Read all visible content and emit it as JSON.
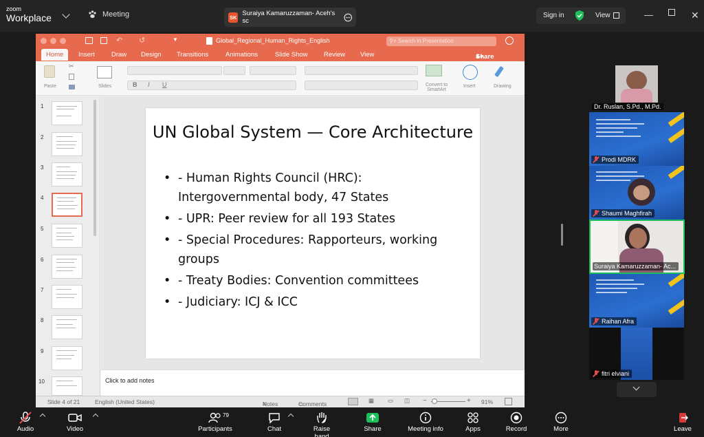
{
  "zoom": {
    "logo_small": "zoom",
    "logo_big": "Workplace",
    "meeting_tab": "Meeting",
    "share_initials": "SK",
    "share_title": "Suraiya Kamaruzzaman- Aceh's sc",
    "sign_in": "Sign in",
    "view": "View",
    "accent": "#1dbf5b"
  },
  "ppt": {
    "filename": "Global_Regional_Human_Rights_English",
    "search_placeholder": "Search in Presentation",
    "tabs": [
      "Home",
      "Insert",
      "Draw",
      "Design",
      "Transitions",
      "Animations",
      "Slide Show",
      "Review",
      "View"
    ],
    "share": "Share",
    "ribbon": {
      "paste": "Paste",
      "slides": "Slides",
      "convert": "Convert to SmartArt",
      "insert": "Insert",
      "drawing": "Drawing"
    },
    "thumb_numbers": [
      "1",
      "2",
      "3",
      "4",
      "5",
      "6",
      "7",
      "8",
      "9",
      "10"
    ],
    "selected_slide": 4,
    "slide": {
      "title": "UN Global System — Core Architecture",
      "bullets": [
        "- Human Rights Council (HRC): Intergovernmental body, 47 States",
        "- UPR: Peer review for all 193 States",
        "- Special Procedures: Rapporteurs, working groups",
        "- Treaty Bodies: Convention committees",
        "- Judiciary: ICJ & ICC"
      ]
    },
    "notes_placeholder": "Click to add notes",
    "status": {
      "slide_of": "Slide 4 of 21",
      "language": "English (United States)",
      "notes": "Notes",
      "comments": "Comments",
      "zoom": "91%"
    },
    "accent": "#e76a4e"
  },
  "participants": [
    {
      "name": "Dr. Ruslan, S.Pd., M.Pd.",
      "type": "video"
    },
    {
      "name": "Prodi MDRK",
      "type": "poster"
    },
    {
      "name": "Shaumi Maghfirah",
      "type": "poster-video"
    },
    {
      "name": "Suraiya Kamaruzzaman- Ac...",
      "type": "video-active"
    },
    {
      "name": "Raihan Afra",
      "type": "poster"
    },
    {
      "name": "fitri elviani",
      "type": "poster-small"
    }
  ],
  "toolbar": {
    "audio": "Audio",
    "video": "Video",
    "participants": "Participants",
    "participants_count": "79",
    "chat": "Chat",
    "raise_hand": "Raise hand",
    "share": "Share",
    "meeting_info": "Meeting info",
    "apps": "Apps",
    "record": "Record",
    "more": "More",
    "leave": "Leave"
  }
}
